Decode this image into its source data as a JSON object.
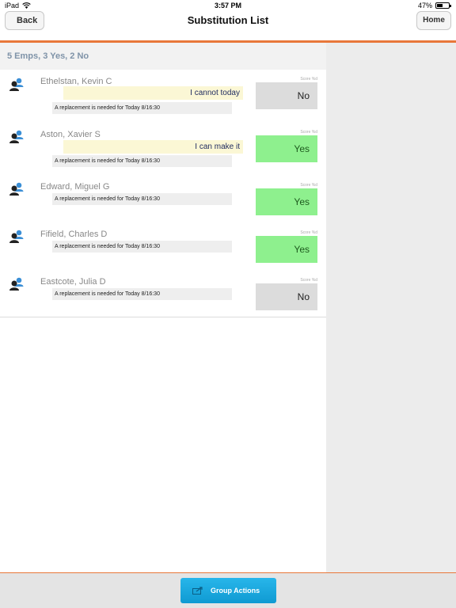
{
  "status": {
    "device": "iPad",
    "time": "3:57 PM",
    "battery": "47%",
    "battery_level": 0.47
  },
  "nav": {
    "back_label": "Back",
    "title": "Substitution List",
    "home_label": "Home"
  },
  "summary": "5 Emps, 3 Yes, 2 No",
  "rows": [
    {
      "name": "Ethelstan, Kevin C",
      "reply": "I cannot today",
      "note": "A replacement is needed for Today 8/16:30",
      "score_label": "Score %d",
      "response": "No"
    },
    {
      "name": "Aston, Xavier S",
      "reply": "I can make it",
      "note": "A replacement is needed for Today 8/16:30",
      "score_label": "Score %d",
      "response": "Yes"
    },
    {
      "name": "Edward, Miguel G",
      "reply": "",
      "note": "A replacement is needed for Today 8/16:30",
      "score_label": "Score %d",
      "response": "Yes"
    },
    {
      "name": "Fifield, Charles D",
      "reply": "",
      "note": "A replacement is needed for Today 8/16:30",
      "score_label": "Score %d",
      "response": "Yes"
    },
    {
      "name": "Eastcote, Julia D",
      "reply": "",
      "note": "A replacement is needed for Today 8/16:30",
      "score_label": "Score %d",
      "response": "No"
    }
  ],
  "footer": {
    "group_actions_label": "Group Actions"
  },
  "colors": {
    "accent": "#e8773a",
    "yes": "#8ef08e",
    "no": "#dcdcdc",
    "button": "#15a5dd",
    "icon_blue": "#3b8fd6"
  },
  "icons": {
    "wifi": "wifi-icon",
    "person": "person-group-icon",
    "group_action": "share-icon"
  }
}
